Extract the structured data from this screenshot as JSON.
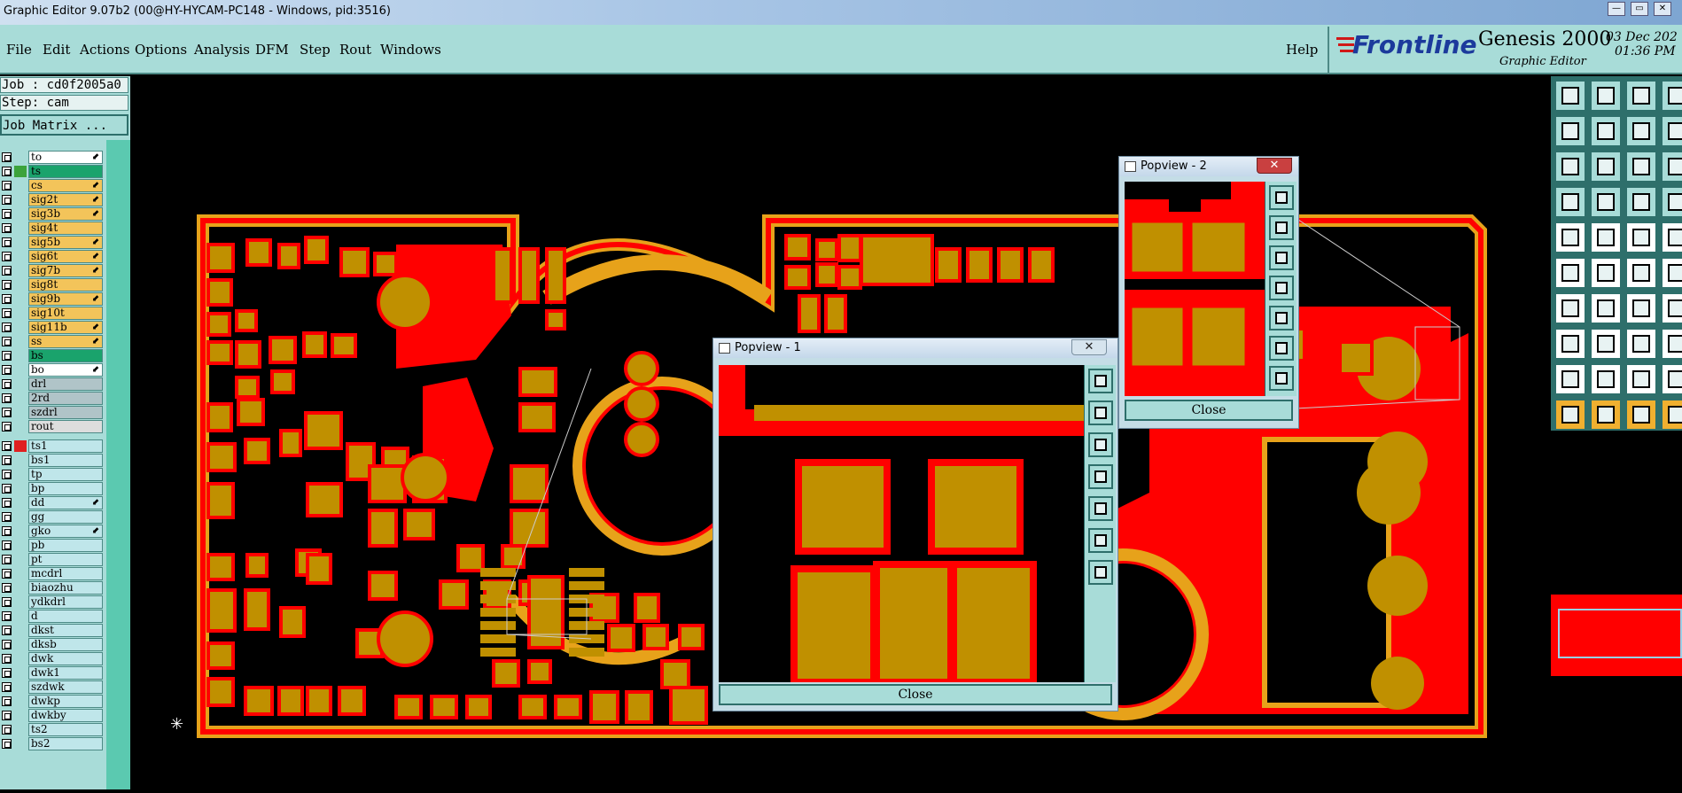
{
  "window": {
    "title": "Graphic Editor 9.07b2 (00@HY-HYCAM-PC148 - Windows, pid:3516)",
    "minimize": "—",
    "restore": "▭",
    "close": "✕"
  },
  "menu": {
    "items": [
      "File",
      "Edit",
      "Actions",
      "Options",
      "Analysis",
      "DFM",
      "Step",
      "Rout",
      "Windows"
    ],
    "help": "Help"
  },
  "brand": {
    "logo": "Frontline",
    "product": "Genesis 2000",
    "subtitle": "Graphic Editor",
    "date": "03 Dec 202",
    "time": "01:36 PM"
  },
  "left": {
    "job": "Job : cd0f2005a0",
    "step": "Step: cam",
    "matrix_button": "Job Matrix ...",
    "board_layers": [
      {
        "name": "to",
        "color": "#ffffff",
        "swatch": "#a8dcd8",
        "arrow": true
      },
      {
        "name": "ts",
        "color": "#1aa36c",
        "swatch": "#3ca33c",
        "arrow": false
      },
      {
        "name": "cs",
        "color": "#f3c45a",
        "swatch": "#a8dcd8",
        "arrow": true
      },
      {
        "name": "sig2t",
        "color": "#f3c45a",
        "swatch": "#a8dcd8",
        "arrow": true
      },
      {
        "name": "sig3b",
        "color": "#f3c45a",
        "swatch": "#a8dcd8",
        "arrow": true
      },
      {
        "name": "sig4t",
        "color": "#f3c45a",
        "swatch": "#a8dcd8",
        "arrow": false
      },
      {
        "name": "sig5b",
        "color": "#f3c45a",
        "swatch": "#a8dcd8",
        "arrow": true
      },
      {
        "name": "sig6t",
        "color": "#f3c45a",
        "swatch": "#a8dcd8",
        "arrow": true
      },
      {
        "name": "sig7b",
        "color": "#f3c45a",
        "swatch": "#a8dcd8",
        "arrow": true
      },
      {
        "name": "sig8t",
        "color": "#f3c45a",
        "swatch": "#a8dcd8",
        "arrow": false
      },
      {
        "name": "sig9b",
        "color": "#f3c45a",
        "swatch": "#a8dcd8",
        "arrow": true
      },
      {
        "name": "sig10t",
        "color": "#f3c45a",
        "swatch": "#a8dcd8",
        "arrow": false
      },
      {
        "name": "sig11b",
        "color": "#f3c45a",
        "swatch": "#a8dcd8",
        "arrow": true
      },
      {
        "name": "ss",
        "color": "#f3c45a",
        "swatch": "#a8dcd8",
        "arrow": true
      },
      {
        "name": "bs",
        "color": "#1aa36c",
        "swatch": "#a8dcd8",
        "arrow": false
      },
      {
        "name": "bo",
        "color": "#ffffff",
        "swatch": "#a8dcd8",
        "arrow": true
      }
    ],
    "drill_layers": [
      {
        "name": "drl",
        "color": "#b0c4c8"
      },
      {
        "name": "2rd",
        "color": "#b0c4c8"
      },
      {
        "name": "szdrl",
        "color": "#b0c4c8"
      },
      {
        "name": "rout",
        "color": "#dddddd"
      }
    ],
    "misc_layers": [
      {
        "name": "ts1",
        "swatch": "#e02020",
        "selected": true,
        "arrow": false
      },
      {
        "name": "bs1"
      },
      {
        "name": "tp"
      },
      {
        "name": "bp"
      },
      {
        "name": "dd",
        "arrow": true
      },
      {
        "name": "gg"
      },
      {
        "name": "gko",
        "arrow": true
      },
      {
        "name": "pb"
      },
      {
        "name": "pt"
      },
      {
        "name": "mcdrl"
      },
      {
        "name": "biaozhu"
      },
      {
        "name": "ydkdrl"
      },
      {
        "name": "d"
      },
      {
        "name": "dkst"
      },
      {
        "name": "dksb"
      },
      {
        "name": "dwk"
      },
      {
        "name": "dwk1"
      },
      {
        "name": "szdwk"
      },
      {
        "name": "dwkp"
      },
      {
        "name": "dwkby"
      },
      {
        "name": "ts2"
      },
      {
        "name": "bs2"
      }
    ]
  },
  "popview1": {
    "title": "Popview - 1",
    "close_label": "Close",
    "close_x": "✕"
  },
  "popview2": {
    "title": "Popview - 2",
    "close_label": "Close",
    "close_x": "✕"
  },
  "colors": {
    "board": "#ff0000",
    "pad": "#c09000",
    "outline": "#e7a21a",
    "panel": "#a8dcd8"
  },
  "toolbar_icons": [
    "snapshot-icon",
    "print-icon",
    "home-icon",
    "help-icon",
    "zoom-icon",
    "graphic-icon",
    "angle-icon",
    "line-icon"
  ]
}
